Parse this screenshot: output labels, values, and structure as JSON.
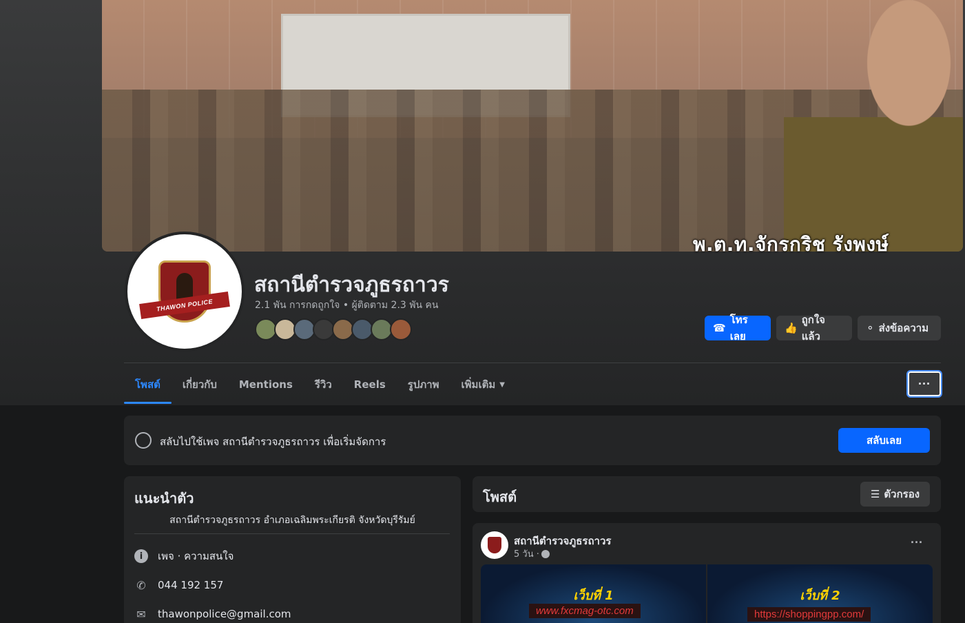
{
  "cover": {
    "caption": "พ.ต.ท.จักรกริช  รังพงษ์"
  },
  "avatar": {
    "badge_text": "THAWON POLICE"
  },
  "page": {
    "name": "สถานีตำรวจภูธรถาวร",
    "stats": "2.1 พัน การกดถูกใจ • ผู้ติดตาม 2.3 พัน คน",
    "friend_colors": [
      "#7a8a5a",
      "#c9b89a",
      "#5a6a7a",
      "#3a3a3a",
      "#8a6a4a",
      "#4a5a6a",
      "#6a7a5a",
      "#9a5a3a"
    ]
  },
  "actions": {
    "call": "โทรเลย",
    "like": "ถูกใจแล้ว",
    "message": "ส่งข้อความ"
  },
  "tabs": [
    {
      "label": "โพสต์",
      "active": true
    },
    {
      "label": "เกี่ยวกับ"
    },
    {
      "label": "Mentions"
    },
    {
      "label": "รีวิว"
    },
    {
      "label": "Reels"
    },
    {
      "label": "รูปภาพ"
    },
    {
      "label": "เพิ่มเติม",
      "dropdown": true
    }
  ],
  "more_button": "···",
  "switch_banner": {
    "text": "สลับไปใช้เพจ สถานีตำรวจภูธรถาวร เพื่อเริ่มจัดการ",
    "button": "สลับเลย"
  },
  "intro": {
    "title": "แนะนำตัว",
    "bio": "สถานีตำรวจภูธรถาวร อำเภอเฉลิมพระเกียรติ จังหวัดบุรีรัมย์",
    "category": "เพจ · ความสนใจ",
    "phone": "044 192 157",
    "email": "thawonpolice@gmail.com"
  },
  "posts": {
    "title": "โพสต์",
    "filter": "ตัวกรอง",
    "post": {
      "author": "สถานีตำรวจภูธรถาวร",
      "time": "5 วัน ·",
      "more": "···",
      "images": [
        {
          "heading": "เว็บที่ 1",
          "url": "www.fxcmag-otc.com"
        },
        {
          "heading": "เว็บที่ 2",
          "url": "https://shoppingpp.com/"
        }
      ]
    }
  },
  "colors": {
    "accent": "#0866ff",
    "tab_active": "#2d88ff",
    "card": "#242526",
    "background": "#18191a"
  }
}
